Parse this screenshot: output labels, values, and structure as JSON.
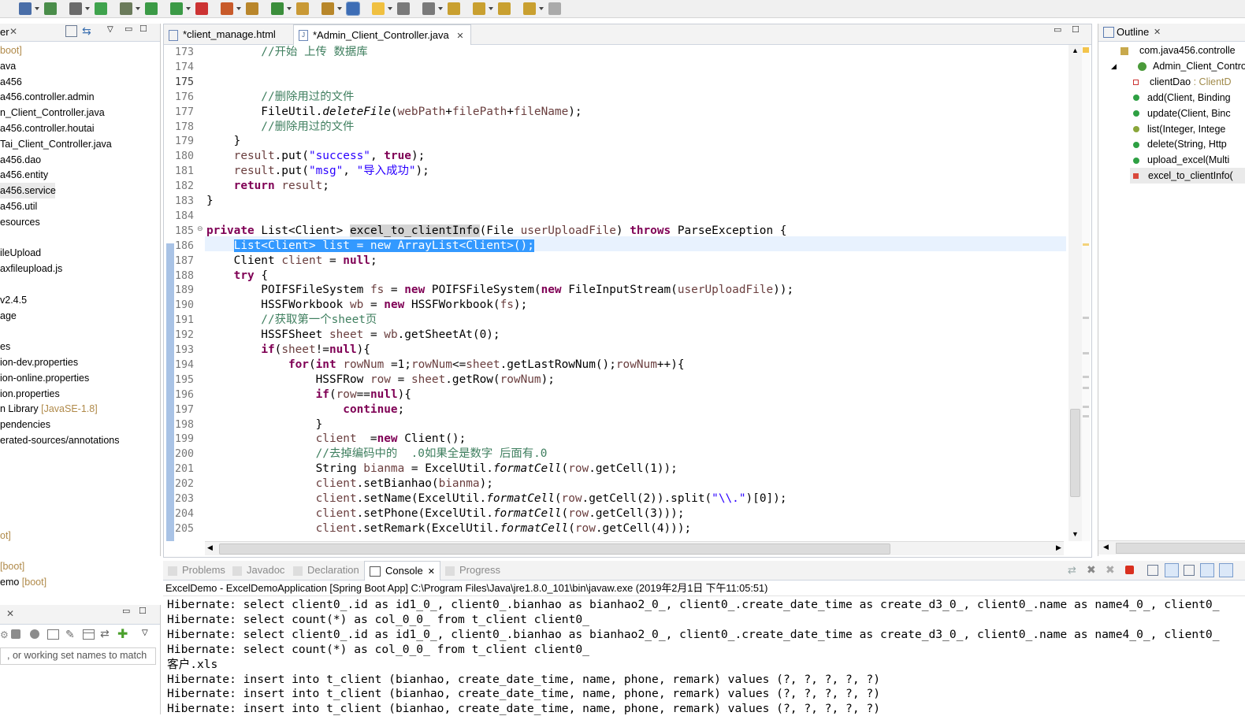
{
  "toolbar": {
    "icons": [
      "save-icon",
      "run-last-icon",
      "skip-breakpoints-icon",
      "spring-boot-icon",
      "debug-icon",
      "run-icon",
      "coverage-icon",
      "stop-icon",
      "external-tools-icon",
      "new-java-package-icon",
      "new-class-icon",
      "open-type-icon",
      "search-icon",
      "toggle-mark-icon",
      "toggle-block-icon",
      "word-wrap-icon",
      "show-whitespace-icon",
      "next-annotation-icon",
      "prev-annotation-icon",
      "last-edit-icon",
      "back-icon",
      "forward-icon"
    ]
  },
  "explorer": {
    "rows": [
      {
        "text": "",
        "dec": "boot]"
      },
      {
        "text": "ava",
        "dec": ""
      },
      {
        "text": "a456",
        "dec": ""
      },
      {
        "text": "a456.controller.admin",
        "dec": ""
      },
      {
        "text": "n_Client_Controller.java",
        "dec": ""
      },
      {
        "text": "a456.controller.houtai",
        "dec": ""
      },
      {
        "text": "Tai_Client_Controller.java",
        "dec": ""
      },
      {
        "text": "a456.dao",
        "dec": ""
      },
      {
        "text": "a456.entity",
        "dec": ""
      },
      {
        "text": "a456.service",
        "dec": ""
      },
      {
        "text": "a456.util",
        "dec": ""
      },
      {
        "text": "esources",
        "dec": ""
      },
      {
        "text": "",
        "dec": ""
      },
      {
        "text": "ileUpload",
        "dec": ""
      },
      {
        "text": "axfileupload.js",
        "dec": ""
      },
      {
        "text": "",
        "dec": ""
      },
      {
        "text": "v2.4.5",
        "dec": ""
      },
      {
        "text": "age",
        "dec": ""
      },
      {
        "text": "",
        "dec": ""
      },
      {
        "text": "es",
        "dec": ""
      },
      {
        "text": "ion-dev.properties",
        "dec": ""
      },
      {
        "text": "ion-online.properties",
        "dec": ""
      },
      {
        "text": "ion.properties",
        "dec": ""
      },
      {
        "text": "n Library ",
        "dec": "[JavaSE-1.8]"
      },
      {
        "text": "pendencies",
        "dec": ""
      },
      {
        "text": "erated-sources/annotations",
        "dec": ""
      }
    ],
    "bottom_rows": [
      {
        "text": "",
        "dec": "ot]"
      },
      {
        "text": "",
        "dec": "[boot]"
      },
      {
        "text": "emo ",
        "dec": "[boot]"
      }
    ]
  },
  "editor": {
    "tabs": [
      {
        "label": "*client_manage.html"
      },
      {
        "label": "*Admin_Client_Controller.java"
      }
    ]
  },
  "outline": {
    "title": "Outline",
    "items": [
      {
        "label": "com.java456.controlle",
        "dec": ""
      },
      {
        "label": "Admin_Client_Control",
        "dec": ""
      },
      {
        "label": "clientDao",
        "dec": " : ClientD"
      },
      {
        "label": "add(Client, Binding",
        "dec": ""
      },
      {
        "label": "update(Client, Binc",
        "dec": ""
      },
      {
        "label": "list(Integer, Intege",
        "dec": ""
      },
      {
        "label": "delete(String, Http",
        "dec": ""
      },
      {
        "label": "upload_excel(Multi",
        "dec": ""
      },
      {
        "label": "excel_to_clientInfo(",
        "dec": ""
      }
    ]
  },
  "console": {
    "tabs": [
      "Problems",
      "Javadoc",
      "Declaration",
      "Console",
      "Progress"
    ],
    "header": "ExcelDemo - ExcelDemoApplication [Spring Boot App] C:\\Program Files\\Java\\jre1.8.0_101\\bin\\javaw.exe (2019年2月1日 下午11:05:51)",
    "lines": [
      "Hibernate: select client0_.id as id1_0_, client0_.bianhao as bianhao2_0_, client0_.create_date_time as create_d3_0_, client0_.name as name4_0_, client0_",
      "Hibernate: select count(*) as col_0_0_ from t_client client0_",
      "Hibernate: select client0_.id as id1_0_, client0_.bianhao as bianhao2_0_, client0_.create_date_time as create_d3_0_, client0_.name as name4_0_, client0_",
      "Hibernate: select count(*) as col_0_0_ from t_client client0_",
      "客户.xls",
      "Hibernate: insert into t_client (bianhao, create_date_time, name, phone, remark) values (?, ?, ?, ?, ?)",
      "Hibernate: insert into t_client (bianhao, create_date_time, name, phone, remark) values (?, ?, ?, ?, ?)",
      "Hibernate: insert into t_client (bianhao, create_date_time, name, phone, remark) values (?, ?, ?, ?, ?)"
    ]
  },
  "bottom_left": {
    "filter_text": ", or working set names to match"
  },
  "code": {
    "lines": [
      {
        "n": "173",
        "t": [
          [
            "cm",
            "        //开始 上传 数据库"
          ]
        ]
      },
      {
        "n": "174",
        "t": []
      },
      {
        "n": "175",
        "t": []
      },
      {
        "n": "176",
        "t": [
          [
            "cm",
            "        //删除用过的文件"
          ]
        ]
      },
      {
        "n": "177",
        "t": [
          [
            "",
            "        FileUtil."
          ],
          [
            "it",
            "deleteFile"
          ],
          [
            "",
            "("
          ],
          [
            "var",
            "webPath"
          ],
          [
            "",
            "+"
          ],
          [
            "var",
            "filePath"
          ],
          [
            "",
            "+"
          ],
          [
            "var",
            "fileName"
          ],
          [
            "",
            ");"
          ]
        ]
      },
      {
        "n": "178",
        "t": [
          [
            "cm",
            "        //删除用过的文件"
          ]
        ]
      },
      {
        "n": "179",
        "t": [
          [
            "",
            "    }"
          ]
        ]
      },
      {
        "n": "180",
        "t": [
          [
            "",
            "    "
          ],
          [
            "var",
            "result"
          ],
          [
            "",
            ".put("
          ],
          [
            "st",
            "\"success\""
          ],
          [
            "",
            ", "
          ],
          [
            "kw",
            "true"
          ],
          [
            "",
            ");"
          ]
        ]
      },
      {
        "n": "181",
        "t": [
          [
            "",
            "    "
          ],
          [
            "var",
            "result"
          ],
          [
            "",
            ".put("
          ],
          [
            "st",
            "\"msg\""
          ],
          [
            "",
            ", "
          ],
          [
            "st",
            "\"导入成功\""
          ],
          [
            "",
            ");"
          ]
        ]
      },
      {
        "n": "182",
        "t": [
          [
            "",
            "    "
          ],
          [
            "kw",
            "return"
          ],
          [
            "",
            " "
          ],
          [
            "var",
            "result"
          ],
          [
            "",
            ";"
          ]
        ]
      },
      {
        "n": "183",
        "t": [
          [
            "",
            "}"
          ]
        ]
      },
      {
        "n": "184",
        "t": []
      },
      {
        "n": "185",
        "t": [
          [
            "kw",
            "private"
          ],
          [
            "",
            " List<Client> "
          ],
          [
            "occ",
            "excel_to_clientInfo"
          ],
          [
            "",
            "(File "
          ],
          [
            "var",
            "userUploadFile"
          ],
          [
            "",
            ") "
          ],
          [
            "kw",
            "throws"
          ],
          [
            "",
            " ParseException {"
          ]
        ]
      },
      {
        "n": "186",
        "t": [
          [
            "",
            "    "
          ],
          [
            "sel",
            "List<Client> list = new ArrayList<Client>();"
          ]
        ]
      },
      {
        "n": "187",
        "t": [
          [
            "",
            "    Client "
          ],
          [
            "var",
            "client"
          ],
          [
            "",
            " = "
          ],
          [
            "kw",
            "null"
          ],
          [
            "",
            ";"
          ]
        ]
      },
      {
        "n": "188",
        "t": [
          [
            "",
            "    "
          ],
          [
            "kw",
            "try"
          ],
          [
            "",
            " {"
          ]
        ]
      },
      {
        "n": "189",
        "t": [
          [
            "",
            "        POIFSFileSystem "
          ],
          [
            "var",
            "fs"
          ],
          [
            "",
            " = "
          ],
          [
            "kw",
            "new"
          ],
          [
            "",
            " POIFSFileSystem("
          ],
          [
            "kw",
            "new"
          ],
          [
            "",
            " FileInputStream("
          ],
          [
            "var",
            "userUploadFile"
          ],
          [
            "",
            "));"
          ]
        ]
      },
      {
        "n": "190",
        "t": [
          [
            "",
            "        HSSFWorkbook "
          ],
          [
            "var",
            "wb"
          ],
          [
            "",
            " = "
          ],
          [
            "kw",
            "new"
          ],
          [
            "",
            " HSSFWorkbook("
          ],
          [
            "var",
            "fs"
          ],
          [
            "",
            ");"
          ]
        ]
      },
      {
        "n": "191",
        "t": [
          [
            "cm",
            "        //获取第一个sheet页"
          ]
        ]
      },
      {
        "n": "192",
        "t": [
          [
            "",
            "        HSSFSheet "
          ],
          [
            "var",
            "sheet"
          ],
          [
            "",
            " = "
          ],
          [
            "var",
            "wb"
          ],
          [
            "",
            ".getSheetAt(0);"
          ]
        ]
      },
      {
        "n": "193",
        "t": [
          [
            "",
            "        "
          ],
          [
            "kw",
            "if"
          ],
          [
            "",
            "("
          ],
          [
            "var",
            "sheet"
          ],
          [
            "",
            "!="
          ],
          [
            "kw",
            "null"
          ],
          [
            "",
            "){"
          ]
        ]
      },
      {
        "n": "194",
        "t": [
          [
            "",
            "            "
          ],
          [
            "kw",
            "for"
          ],
          [
            "",
            "("
          ],
          [
            "kw",
            "int"
          ],
          [
            "",
            " "
          ],
          [
            "var",
            "rowNum"
          ],
          [
            "",
            " =1;"
          ],
          [
            "var",
            "rowNum"
          ],
          [
            "",
            "<="
          ],
          [
            "var",
            "sheet"
          ],
          [
            "",
            ".getLastRowNum();"
          ],
          [
            "var",
            "rowNum"
          ],
          [
            "",
            "++){"
          ]
        ]
      },
      {
        "n": "195",
        "t": [
          [
            "",
            "                HSSFRow "
          ],
          [
            "var",
            "row"
          ],
          [
            "",
            " = "
          ],
          [
            "var",
            "sheet"
          ],
          [
            "",
            ".getRow("
          ],
          [
            "var",
            "rowNum"
          ],
          [
            "",
            ");"
          ]
        ]
      },
      {
        "n": "196",
        "t": [
          [
            "",
            "                "
          ],
          [
            "kw",
            "if"
          ],
          [
            "",
            "("
          ],
          [
            "var",
            "row"
          ],
          [
            "",
            "=="
          ],
          [
            "kw",
            "null"
          ],
          [
            "",
            "){"
          ]
        ]
      },
      {
        "n": "197",
        "t": [
          [
            "",
            "                    "
          ],
          [
            "kw",
            "continue"
          ],
          [
            "",
            ";"
          ]
        ]
      },
      {
        "n": "198",
        "t": [
          [
            "",
            "                }"
          ]
        ]
      },
      {
        "n": "199",
        "t": [
          [
            "",
            "                "
          ],
          [
            "var",
            "client"
          ],
          [
            "",
            "  ="
          ],
          [
            "kw",
            "new"
          ],
          [
            "",
            " Client();"
          ]
        ]
      },
      {
        "n": "200",
        "t": [
          [
            "cm",
            "                //去掉编码中的  .0如果全是数字 后面有.0"
          ]
        ]
      },
      {
        "n": "201",
        "t": [
          [
            "",
            "                String "
          ],
          [
            "var",
            "bianma"
          ],
          [
            "",
            " = ExcelUtil."
          ],
          [
            "it",
            "formatCell"
          ],
          [
            "",
            "("
          ],
          [
            "var",
            "row"
          ],
          [
            "",
            ".getCell(1));"
          ]
        ]
      },
      {
        "n": "202",
        "t": [
          [
            "",
            "                "
          ],
          [
            "var",
            "client"
          ],
          [
            "",
            ".setBianhao("
          ],
          [
            "var",
            "bianma"
          ],
          [
            "",
            ");"
          ]
        ]
      },
      {
        "n": "203",
        "t": [
          [
            "",
            "                "
          ],
          [
            "var",
            "client"
          ],
          [
            "",
            ".setName(ExcelUtil."
          ],
          [
            "it",
            "formatCell"
          ],
          [
            "",
            "("
          ],
          [
            "var",
            "row"
          ],
          [
            "",
            ".getCell(2)).split("
          ],
          [
            "st",
            "\"\\\\.\""
          ],
          [
            "",
            ")[0]);"
          ]
        ]
      },
      {
        "n": "204",
        "t": [
          [
            "",
            "                "
          ],
          [
            "var",
            "client"
          ],
          [
            "",
            ".setPhone(ExcelUtil."
          ],
          [
            "it",
            "formatCell"
          ],
          [
            "",
            "("
          ],
          [
            "var",
            "row"
          ],
          [
            "",
            ".getCell(3)));"
          ]
        ]
      },
      {
        "n": "205",
        "t": [
          [
            "",
            "                "
          ],
          [
            "var",
            "client"
          ],
          [
            "",
            ".setRemark(ExcelUtil."
          ],
          [
            "it",
            "formatCell"
          ],
          [
            "",
            "("
          ],
          [
            "var",
            "row"
          ],
          [
            "",
            ".getCell(4)));"
          ]
        ]
      }
    ]
  }
}
